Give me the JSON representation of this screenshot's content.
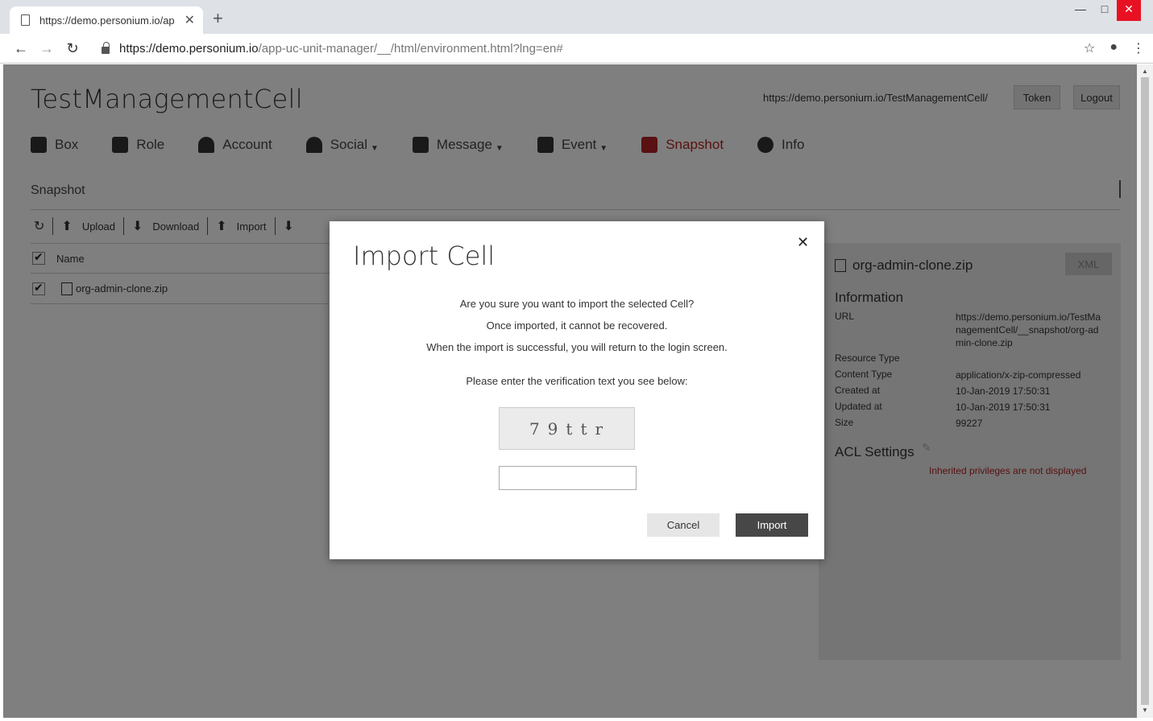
{
  "browser": {
    "tab_title": "https://demo.personium.io/ap",
    "url_host": "https://demo.personium.io",
    "url_path": "/app-uc-unit-manager/__/html/environment.html?lng=en#"
  },
  "header": {
    "cell_name": "TestManagementCell",
    "cell_url": "https://demo.personium.io/TestManagementCell/",
    "token_label": "Token",
    "logout_label": "Logout"
  },
  "menu": [
    {
      "label": "Box",
      "icon": "box-icon"
    },
    {
      "label": "Role",
      "icon": "role-icon"
    },
    {
      "label": "Account",
      "icon": "account-icon"
    },
    {
      "label": "Social",
      "icon": "social-icon"
    },
    {
      "label": "Message",
      "icon": "message-icon"
    },
    {
      "label": "Event",
      "icon": "event-icon"
    },
    {
      "label": "Snapshot",
      "icon": "snapshot-icon",
      "active": true
    },
    {
      "label": "Info",
      "icon": "info-icon"
    }
  ],
  "breadcrumb": "Snapshot",
  "list_toolbar": {
    "upload": "Upload",
    "download": "Download",
    "import": "Import"
  },
  "list": {
    "column_name": "Name",
    "rows": [
      "org-admin-clone.zip"
    ]
  },
  "detail": {
    "file_name": "org-admin-clone.zip",
    "xml_label": "XML",
    "information_title": "Information",
    "fields": [
      {
        "label": "URL",
        "value": "https://demo.personium.io/TestManagementCell/__snapshot/org-admin-clone.zip"
      },
      {
        "label": "Resource Type",
        "value": ""
      },
      {
        "label": "Content Type",
        "value": "application/x-zip-compressed"
      },
      {
        "label": "Created at",
        "value": "10-Jan-2019 17:50:31"
      },
      {
        "label": "Updated at",
        "value": "10-Jan-2019 17:50:31"
      },
      {
        "label": "Size",
        "value": "99227"
      }
    ],
    "acl_title": "ACL Settings",
    "acl_note": "Inherited privileges are not displayed"
  },
  "modal": {
    "title": "Import Cell",
    "line1": "Are you sure you want to import the selected Cell?",
    "line2": "Once imported, it cannot be recovered.",
    "line3": "When the import is successful, you will return to the login screen.",
    "prompt": "Please enter the verification text you see below:",
    "captcha": "79ttr",
    "input_value": "",
    "cancel_label": "Cancel",
    "import_label": "Import"
  },
  "colors": {
    "accent": "#b22222",
    "primary_button": "#474747"
  }
}
